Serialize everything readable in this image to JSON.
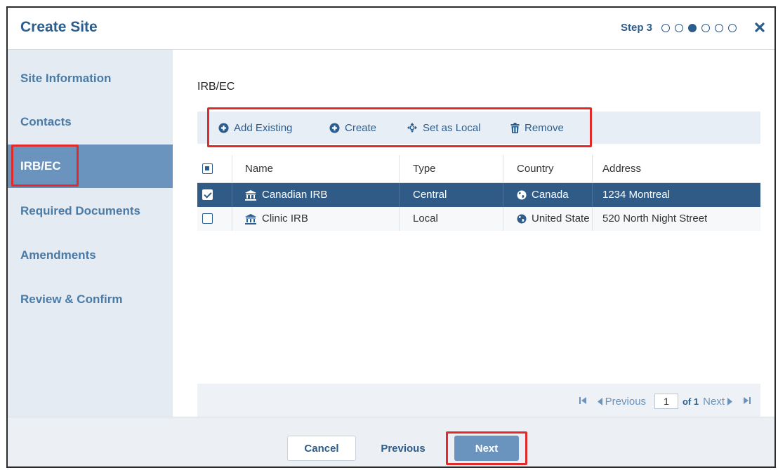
{
  "header": {
    "title": "Create Site",
    "step_label": "Step 3",
    "step_total": 6,
    "step_current": 3
  },
  "sidebar": {
    "items": [
      {
        "label": "Site Information",
        "active": false
      },
      {
        "label": "Contacts",
        "active": false
      },
      {
        "label": "IRB/EC",
        "active": true
      },
      {
        "label": "Required Documents",
        "active": false
      },
      {
        "label": "Amendments",
        "active": false
      },
      {
        "label": "Review & Confirm",
        "active": false
      }
    ]
  },
  "main": {
    "section_title": "IRB/EC",
    "toolbar": {
      "add_existing": "Add Existing",
      "create": "Create",
      "set_as_local": "Set as Local",
      "remove": "Remove"
    },
    "table": {
      "columns": [
        "Name",
        "Type",
        "Country",
        "Address"
      ],
      "rows": [
        {
          "name": "Canadian IRB",
          "type": "Central",
          "country": "Canada",
          "address": "1234 Montreal",
          "selected": true,
          "icon": "institution-icon",
          "country_icon": "globe-icon"
        },
        {
          "name": "Clinic IRB",
          "type": "Local",
          "country": "United States",
          "address": "520 North Night Street",
          "selected": false,
          "icon": "institution-icon",
          "country_icon": "globe-icon"
        }
      ]
    },
    "pager": {
      "previous": "Previous",
      "page": "1",
      "of_label": "of 1",
      "next": "Next"
    }
  },
  "footer": {
    "cancel": "Cancel",
    "previous": "Previous",
    "next": "Next"
  },
  "colors": {
    "brand": "#2d5d8c",
    "sidebar_active": "#6a94bd",
    "selected_row": "#2f5b86",
    "highlight": "#e02b2b"
  }
}
